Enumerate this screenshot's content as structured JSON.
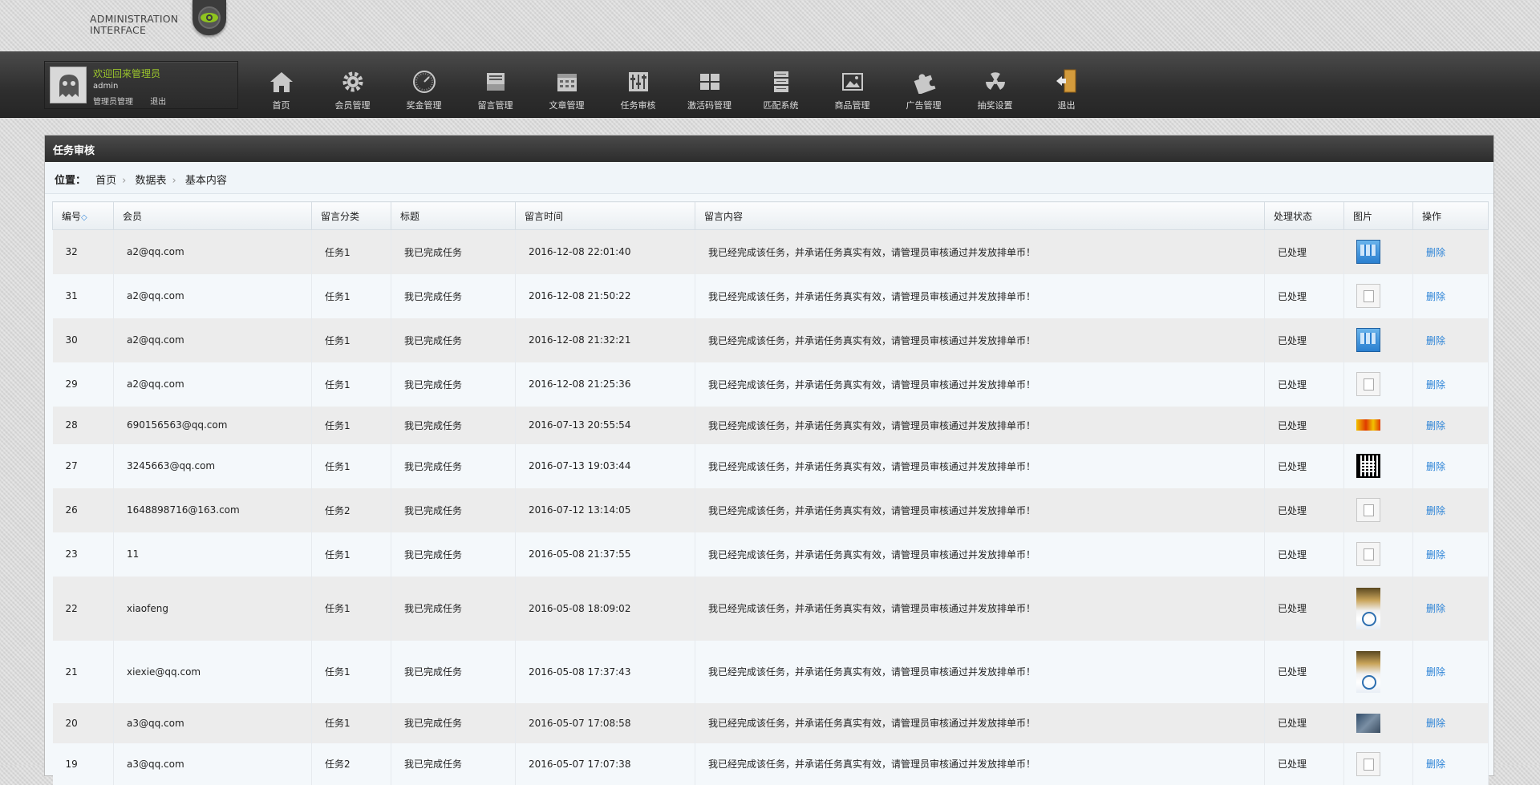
{
  "brand": {
    "line1": "ADMINISTRATION",
    "line2": "INTERFACE"
  },
  "user": {
    "welcome": "欢迎回来管理员",
    "name": "admin",
    "links": [
      "管理员管理",
      "退出"
    ]
  },
  "nav": [
    {
      "label": "首页",
      "icon": "home-icon"
    },
    {
      "label": "会员管理",
      "icon": "gear-icon"
    },
    {
      "label": "奖金管理",
      "icon": "gauge-icon"
    },
    {
      "label": "留言管理",
      "icon": "inbox-icon"
    },
    {
      "label": "文章管理",
      "icon": "calendar-icon"
    },
    {
      "label": "任务审核",
      "icon": "sliders-icon"
    },
    {
      "label": "激活码管理",
      "icon": "grid-icon"
    },
    {
      "label": "匹配系统",
      "icon": "server-icon"
    },
    {
      "label": "商品管理",
      "icon": "image-icon"
    },
    {
      "label": "广告管理",
      "icon": "puzzle-icon"
    },
    {
      "label": "抽奖设置",
      "icon": "radiation-icon"
    },
    {
      "label": "退出",
      "icon": "exit-door-icon"
    }
  ],
  "panel": {
    "title": "任务审核"
  },
  "breadcrumb": {
    "label": "位置：",
    "items": [
      "首页",
      "数据表",
      "基本内容"
    ]
  },
  "table": {
    "headers": [
      "编号",
      "会员",
      "留言分类",
      "标题",
      "留言时间",
      "留言内容",
      "处理状态",
      "图片",
      "操作"
    ],
    "sort_icon": "◇",
    "rows": [
      {
        "id": "32",
        "member": "a2@qq.com",
        "category": "任务1",
        "title": "我已完成任务",
        "time": "2016-12-08 22:01:40",
        "content": "我已经完成该任务，并承诺任务真实有效，请管理员审核通过并发放排单币！",
        "status": "已处理",
        "image": "blue",
        "action": "删除"
      },
      {
        "id": "31",
        "member": "a2@qq.com",
        "category": "任务1",
        "title": "我已完成任务",
        "time": "2016-12-08 21:50:22",
        "content": "我已经完成该任务，并承诺任务真实有效，请管理员审核通过并发放排单币！",
        "status": "已处理",
        "image": "broken",
        "action": "删除"
      },
      {
        "id": "30",
        "member": "a2@qq.com",
        "category": "任务1",
        "title": "我已完成任务",
        "time": "2016-12-08 21:32:21",
        "content": "我已经完成该任务，并承诺任务真实有效，请管理员审核通过并发放排单币！",
        "status": "已处理",
        "image": "blue",
        "action": "删除"
      },
      {
        "id": "29",
        "member": "a2@qq.com",
        "category": "任务1",
        "title": "我已完成任务",
        "time": "2016-12-08 21:25:36",
        "content": "我已经完成该任务，并承诺任务真实有效，请管理员审核通过并发放排单币！",
        "status": "已处理",
        "image": "broken",
        "action": "删除"
      },
      {
        "id": "28",
        "member": "690156563@qq.com",
        "category": "任务1",
        "title": "我已完成任务",
        "time": "2016-07-13 20:55:54",
        "content": "我已经完成该任务，并承诺任务真实有效，请管理员审核通过并发放排单币！",
        "status": "已处理",
        "image": "banner",
        "action": "删除"
      },
      {
        "id": "27",
        "member": "3245663@qq.com",
        "category": "任务1",
        "title": "我已完成任务",
        "time": "2016-07-13 19:03:44",
        "content": "我已经完成该任务，并承诺任务真实有效，请管理员审核通过并发放排单币！",
        "status": "已处理",
        "image": "qr",
        "action": "删除"
      },
      {
        "id": "26",
        "member": "1648898716@163.com",
        "category": "任务2",
        "title": "我已完成任务",
        "time": "2016-07-12 13:14:05",
        "content": "我已经完成该任务，并承诺任务真实有效，请管理员审核通过并发放排单币！",
        "status": "已处理",
        "image": "broken",
        "action": "删除"
      },
      {
        "id": "23",
        "member": "11",
        "category": "任务1",
        "title": "我已完成任务",
        "time": "2016-05-08 21:37:55",
        "content": "我已经完成该任务，并承诺任务真实有效，请管理员审核通过并发放排单币！",
        "status": "已处理",
        "image": "broken",
        "action": "删除"
      },
      {
        "id": "22",
        "member": "xiaofeng",
        "category": "任务1",
        "title": "我已完成任务",
        "time": "2016-05-08 18:09:02",
        "content": "我已经完成该任务，并承诺任务真实有效，请管理员审核通过并发放排单币！",
        "status": "已处理",
        "image": "tall",
        "action": "删除"
      },
      {
        "id": "21",
        "member": "xiexie@qq.com",
        "category": "任务1",
        "title": "我已完成任务",
        "time": "2016-05-08 17:37:43",
        "content": "我已经完成该任务，并承诺任务真实有效，请管理员审核通过并发放排单币！",
        "status": "已处理",
        "image": "tall",
        "action": "删除"
      },
      {
        "id": "20",
        "member": "a3@qq.com",
        "category": "任务1",
        "title": "我已完成任务",
        "time": "2016-05-07 17:08:58",
        "content": "我已经完成该任务，并承诺任务真实有效，请管理员审核通过并发放排单币！",
        "status": "已处理",
        "image": "photo",
        "action": "删除"
      },
      {
        "id": "19",
        "member": "a3@qq.com",
        "category": "任务2",
        "title": "我已完成任务",
        "time": "2016-05-07 17:07:38",
        "content": "我已经完成该任务，并承诺任务真实有效，请管理员审核通过并发放排单币！",
        "status": "已处理",
        "image": "broken",
        "action": "删除"
      }
    ]
  }
}
